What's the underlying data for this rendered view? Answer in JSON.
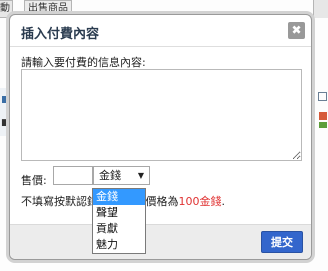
{
  "background": {
    "tab_left": "動",
    "tab_label": "出售商品"
  },
  "dialog": {
    "title": "插入付費內容",
    "close_glyph": "✖",
    "prompt": "請輸入要付費的信息內容:",
    "price_label": "售價:",
    "price_value": "",
    "currency_selected": "金錢",
    "hint_prefix": "不填寫按默認",
    "hint_middle": "錢,最大出售價格為",
    "hint_highlight": "100金錢",
    "hint_suffix": ".",
    "submit_label": "提交"
  },
  "currency_options": [
    "金錢",
    "聲望",
    "貢獻",
    "魅力"
  ],
  "colors": {
    "accent": "#3366cc",
    "highlight": "#e03333",
    "selection": "#3399ff"
  }
}
